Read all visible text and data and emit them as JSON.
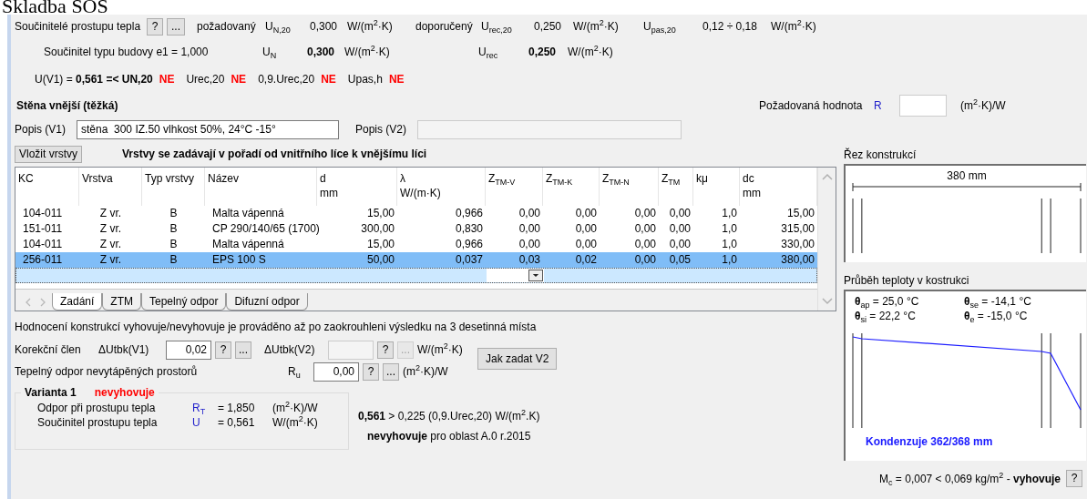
{
  "page_heading": "Skladba SOS",
  "coefficients": {
    "label": "Součinitelé prostupu tepla",
    "help_button": "?",
    "more_button": "...",
    "required": {
      "label": "požadovaný",
      "symbol": "U$_{N,20}$",
      "value": "0,300",
      "unit": "W/(m$^{2}$·K)"
    },
    "recommended": {
      "label": "doporučený",
      "symbol": "U$_{rec,20}$",
      "value": "0,250",
      "unit": "W/(m$^{2}$·K)"
    },
    "passive": {
      "symbol": "U$_{pas,20}$",
      "value": "0,12 ÷ 0,18",
      "unit": "W/(m$^{2}$·K)"
    }
  },
  "building_type": {
    "label": "Součinitel typu budovy  e1 = 1,000",
    "un_symbol": "U$_{N}$",
    "un_value": "0,300",
    "un_unit": "W/(m$^{2}$·K)",
    "urec_symbol": "U$_{rec}$",
    "urec_value": "0,250",
    "urec_unit": "W/(m$^{2}$·K)"
  },
  "verdicts": [
    {
      "label": "U(V1) = **0,561 =< UN,20**",
      "result": "NE",
      "passed": false
    },
    {
      "label": "Urec,20",
      "result": "NE",
      "passed": false
    },
    {
      "label": "0,9.Urec,20",
      "result": "NE",
      "passed": false
    },
    {
      "label": "Upas,h",
      "result": "NE",
      "passed": false
    }
  ],
  "construction_title": "Stěna vnější (těžká)",
  "required_value": {
    "label": "Požadovaná hodnota",
    "symbol": "R",
    "unit": "(m$^{2}$·K)/W"
  },
  "description": {
    "v1_label": "Popis (V1)",
    "v1_value": "stěna  300 IZ.50 vlhkost 50%, 24°C -15°",
    "v2_label": "Popis (V2)",
    "v2_disabled": true
  },
  "insert_button": "Vložit vrstvy",
  "layers_note": "Vrstvy se zadávají v pořadí od vnitřního líce k vnějšímu líci",
  "table": {
    "columns": [
      {
        "label": "KC"
      },
      {
        "label": "Vrstva"
      },
      {
        "label": "Typ vrstvy"
      },
      {
        "label": "Název"
      },
      {
        "label": "d",
        "unit": "mm"
      },
      {
        "label": "λ",
        "unit": "W/(m·K)"
      },
      {
        "label": "Z$_{TM-V}$"
      },
      {
        "label": "Z$_{TM-K}$"
      },
      {
        "label": "Z$_{TM-N}$"
      },
      {
        "label": "Z$_{TM}$"
      },
      {
        "label": "kμ"
      },
      {
        "label": "dc",
        "unit": "mm"
      }
    ],
    "rows": [
      {
        "cells": [
          "104-011",
          "Z vr.",
          "B",
          "Malta vápenná",
          "15,00",
          "0,966",
          "0,00",
          "0,00",
          "0,00",
          "0,00",
          "1,0",
          "15,00"
        ],
        "selected": false
      },
      {
        "cells": [
          "151-011",
          "Z vr.",
          "B",
          "CP 290/140/65 (1700)",
          "300,00",
          "0,830",
          "0,00",
          "0,00",
          "0,00",
          "0,00",
          "1,0",
          "315,00"
        ],
        "selected": false
      },
      {
        "cells": [
          "104-011",
          "Z vr.",
          "B",
          "Malta vápenná",
          "15,00",
          "0,966",
          "0,00",
          "0,00",
          "0,00",
          "0,00",
          "1,0",
          "330,00"
        ],
        "selected": false
      },
      {
        "cells": [
          "256-011",
          "Z vr.",
          "B",
          "EPS 100 S",
          "50,00",
          "0,037",
          "0,03",
          "0,02",
          "0,00",
          "0,05",
          "1,0",
          "380,00"
        ],
        "selected": true
      }
    ]
  },
  "tabs": [
    {
      "label": "Zadání",
      "selected": true
    },
    {
      "label": "ZTM",
      "selected": false
    },
    {
      "label": "Tepelný odpor",
      "selected": false
    },
    {
      "label": "Difuzní odpor",
      "selected": false
    }
  ],
  "rounding_note": "Hodnocení konstrukcí vyhovuje/nevyhovuje je prováděno až po zaokrouhleni výsledku na 3 desetinná místa",
  "correction": {
    "label": "Korekční člen",
    "v1_symbol": "ΔUtbk(V1)",
    "v1_value": "0,02",
    "v1_buttons": [
      {
        "label": "?",
        "disabled": false
      },
      {
        "label": "...",
        "disabled": false
      }
    ],
    "v2_symbol": "ΔUtbk(V2)",
    "v2_disabled": true,
    "v2_buttons": [
      {
        "label": "?",
        "disabled": false
      },
      {
        "label": "...",
        "disabled": true
      }
    ],
    "unit": "W/(m$^{2}$·K)"
  },
  "unheated": {
    "label": "Tepelný odpor nevytápěných prostorů",
    "symbol": "R$_{u}$",
    "value": "0,00",
    "buttons": [
      {
        "label": "?",
        "disabled": false
      },
      {
        "label": "...",
        "disabled": false
      }
    ],
    "unit": "(m$^{2}$·K)/W"
  },
  "how_v2_button": "Jak zadat V2",
  "variant": {
    "title": "Varianta 1",
    "status": "nevyhovuje",
    "passed": false,
    "rows": [
      {
        "label": "Odpor při prostupu tepla",
        "symbol": "R$_{T}$",
        "value": "= 1,850",
        "unit": "(m$^{2}$·K)/W"
      },
      {
        "label": "Součinitel prostupu tepla",
        "symbol": "U",
        "value": "= 0,561",
        "unit": "W/(m$^{2}$·K)"
      }
    ]
  },
  "summary": {
    "comparison": "**0,561** > 0,225 (0,9.Urec,20) W/(m$^{2}$.K)",
    "verdict": "**nevyhovuje** pro oblast A.0 r.2015"
  },
  "section_view": {
    "title": "Řez konstrukcí",
    "dimension": "380 mm"
  },
  "temperature": {
    "title": "Průběh teploty v kostrukci",
    "readings": [
      "**θ**$_{ap}$ =  25,0 °C",
      "**θ**$_{se}$ = -14,1 °C",
      "**θ**$_{si}$  =  22,2 °C",
      "**θ**$_{e}$  = -15,0 °C"
    ],
    "condensation": "Kondenzuje 362/368 mm"
  },
  "condensate": {
    "text": "M$_{c}$ = 0,007 < 0,069 kg/m$^{2}$  -  **vyhovuje**",
    "help_button": "?"
  }
}
